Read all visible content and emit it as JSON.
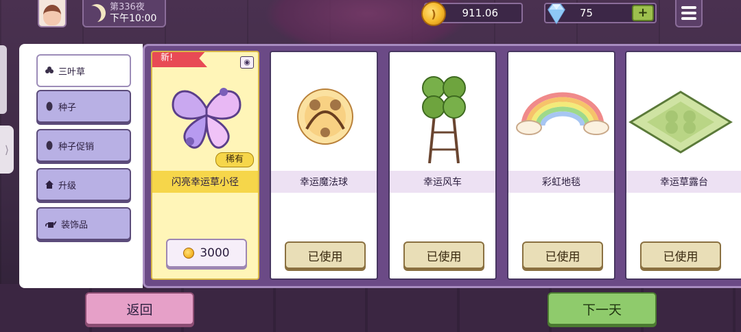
{
  "hud": {
    "night": "第336夜",
    "clock": "下午10:00",
    "coins": "911.06",
    "gems": "75",
    "plus": "+"
  },
  "categories": [
    {
      "label": "三叶草",
      "icon": "clover-icon",
      "active": true
    },
    {
      "label": "种子",
      "icon": "seed-icon",
      "active": false
    },
    {
      "label": "种子促销",
      "icon": "seed-icon",
      "active": false
    },
    {
      "label": "升级",
      "icon": "house-icon",
      "active": false
    },
    {
      "label": "装饰品",
      "icon": "watering-can-icon",
      "active": false
    }
  ],
  "items": [
    {
      "name": "闪亮幸运草小径",
      "tag": "新!",
      "rarity": "稀有",
      "price": "3000",
      "art": "shiny-clover-path-icon"
    },
    {
      "name": "幸运魔法球",
      "status": "已使用",
      "art": "magic-ball-icon"
    },
    {
      "name": "幸运风车",
      "status": "已使用",
      "art": "windmill-icon"
    },
    {
      "name": "彩虹地毯",
      "status": "已使用",
      "art": "rainbow-rug-icon"
    },
    {
      "name": "幸运草露台",
      "status": "已使用",
      "art": "clover-terrace-icon"
    }
  ],
  "buttons": {
    "back": "返回",
    "next_day": "下一天"
  },
  "colors": {
    "panel": "#6b4a86",
    "featured_card": "#fff5b8",
    "next_button": "#8fcb6c",
    "back_button": "#e6a0c8"
  }
}
